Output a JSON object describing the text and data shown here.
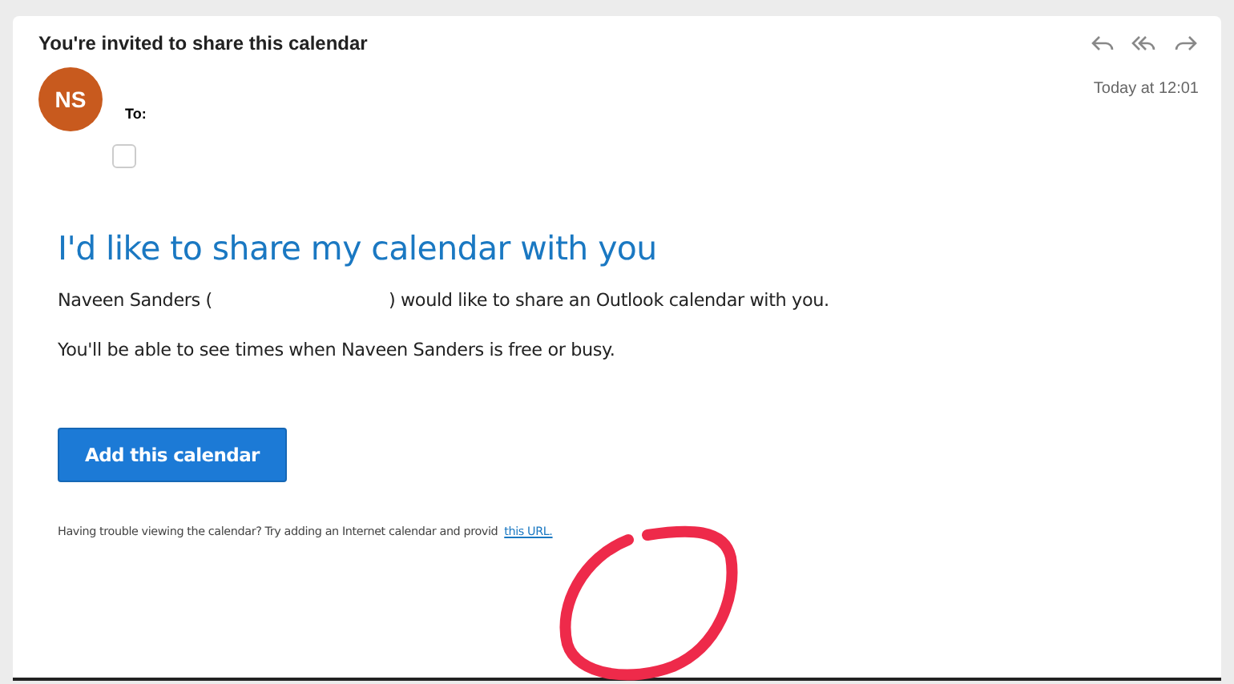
{
  "email": {
    "subject": "You're invited to share this calendar",
    "avatar": {
      "initials": "NS",
      "color": "#c85a1e"
    },
    "to_label": "To:",
    "checkbox": {
      "checked": false
    },
    "time": "Today at 12:01",
    "heading": "I'd like to share my calendar with you",
    "intro_before": "Naveen Sanders (",
    "intro_after": ") would like to share an Outlook calendar with you.",
    "note": "You'll be able to see times when Naveen Sanders is free or busy.",
    "button": "Add this calendar",
    "footer_text": "Having trouble viewing the calendar? Try adding an Internet calendar and provid",
    "footer_link": "this URL."
  }
}
